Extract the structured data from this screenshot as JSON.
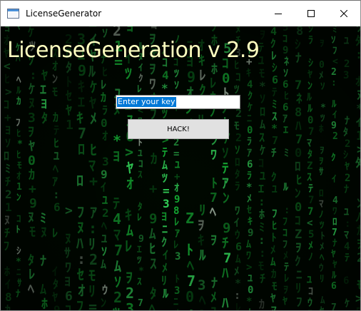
{
  "window": {
    "title": "LicenseGenerator",
    "icon": "app-window-icon",
    "controls": [
      "minimize-icon",
      "maximize-icon",
      "close-icon"
    ]
  },
  "main": {
    "headline": "LicenseGeneration v 2.9",
    "key_input": {
      "value": "Enter your key",
      "placeholder": "Enter your key"
    },
    "hack_button_label": "HACK!"
  },
  "colors": {
    "matrix_green": "#22ff55",
    "matrix_dark": "#000800",
    "headline": "#ffffc0",
    "selection": "#0078d7",
    "button_face": "#e1e1e1"
  }
}
